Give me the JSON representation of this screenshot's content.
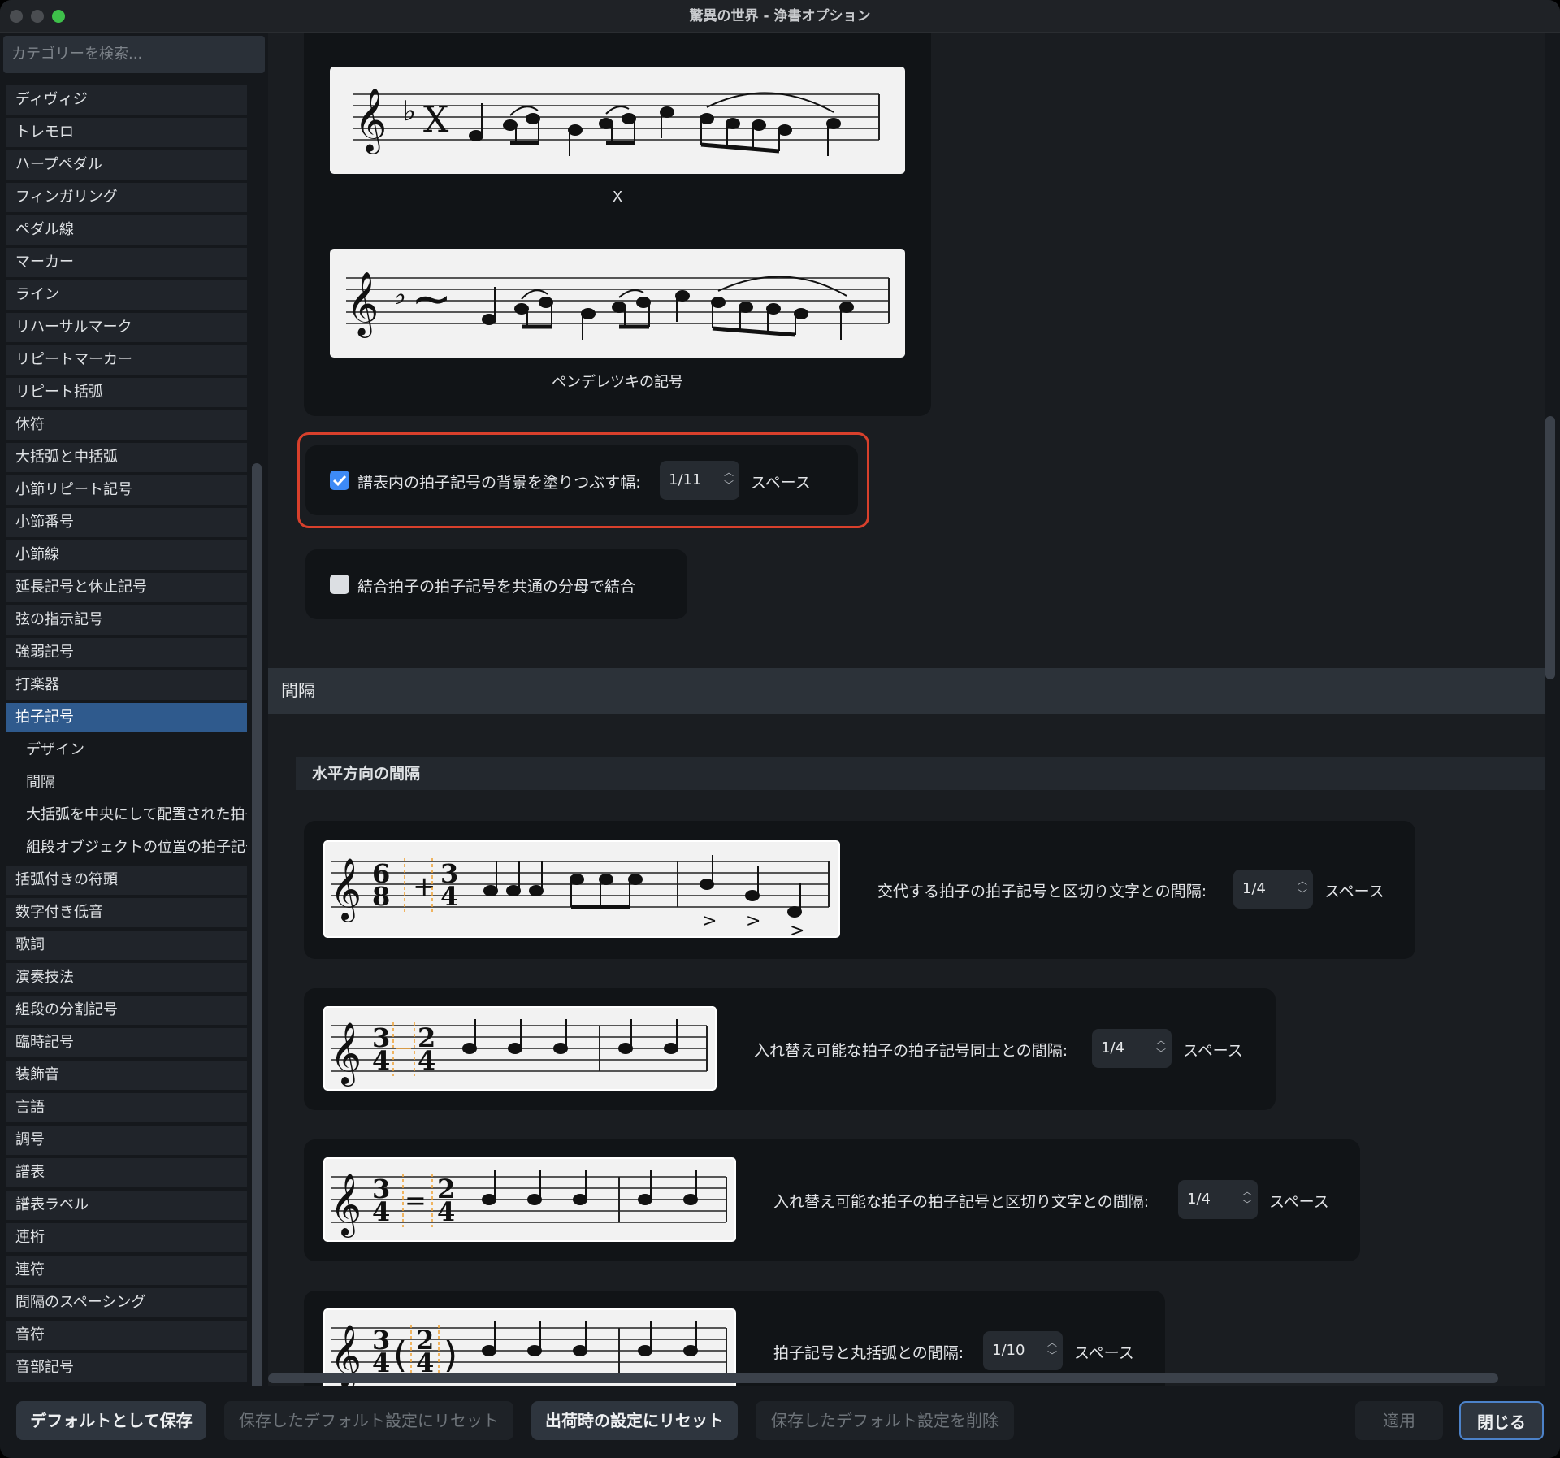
{
  "window": {
    "title": "驚異の世界 - 浄書オプション"
  },
  "sidebar": {
    "search_placeholder": "カテゴリーを検索...",
    "items": [
      "ディヴィジ",
      "トレモロ",
      "ハープペダル",
      "フィンガリング",
      "ペダル線",
      "マーカー",
      "ライン",
      "リハーサルマーク",
      "リピートマーカー",
      "リピート括弧",
      "休符",
      "大括弧と中括弧",
      "小節リピート記号",
      "小節番号",
      "小節線",
      "延長記号と休止記号",
      "弦の指示記号",
      "強弱記号",
      "打楽器"
    ],
    "active_item": "拍子記号",
    "sub_items": [
      "デザイン",
      "間隔",
      "大括弧を中央にして配置された拍子記号",
      "組段オブジェクトの位置の拍子記号"
    ],
    "items_after": [
      "括弧付きの符頭",
      "数字付き低音",
      "歌詞",
      "演奏技法",
      "組段の分割記号",
      "臨時記号",
      "装飾音",
      "言語",
      "調号",
      "譜表",
      "譜表ラベル",
      "連桁",
      "連符",
      "間隔のスペーシング",
      "音符",
      "音部記号"
    ]
  },
  "design": {
    "caption_x": "X",
    "caption_penderecki": "ペンデレツキの記号",
    "fill_option": {
      "label": "譜表内の拍子記号の背景を塗りつぶす幅:",
      "value": "1/11",
      "unit": "スペース",
      "checked": true
    },
    "combine_option": {
      "label": "結合拍子の拍子記号を共通の分母で結合",
      "checked": false
    }
  },
  "spacing": {
    "header": "間隔",
    "subheader": "水平方向の間隔",
    "rows": [
      {
        "label": "交代する拍子の拍子記号と区切り文字との間隔:",
        "value": "1/4",
        "unit": "スペース"
      },
      {
        "label": "入れ替え可能な拍子の拍子記号同士との間隔:",
        "value": "1/4",
        "unit": "スペース"
      },
      {
        "label": "入れ替え可能な拍子の拍子記号と区切り文字との間隔:",
        "value": "1/4",
        "unit": "スペース"
      },
      {
        "label": "拍子記号と丸括弧との間隔:",
        "value": "1/10",
        "unit": "スペース"
      }
    ]
  },
  "music": {
    "clef": "𝄞",
    "flat": "♭",
    "x_sig": "X",
    "tilde": "∼",
    "ts_68_top": "6",
    "ts_68_bot": "8",
    "ts_34_top": "3",
    "ts_34_bot": "4",
    "ts_24_top": "2",
    "ts_24_bot": "4",
    "plus": "+",
    "equals": "=",
    "lparen": "(",
    "rparen": ")",
    "accent": ">"
  },
  "footer": {
    "save_default": "デフォルトとして保存",
    "reset_saved": "保存したデフォルト設定にリセット",
    "reset_factory": "出荷時の設定にリセット",
    "delete_saved": "保存したデフォルト設定を削除",
    "apply": "適用",
    "close": "閉じる"
  },
  "colors": {
    "accent": "#3d8af5",
    "highlight": "#d8402c",
    "active_item": "#2f5a8d",
    "guide": "#f0a030"
  }
}
